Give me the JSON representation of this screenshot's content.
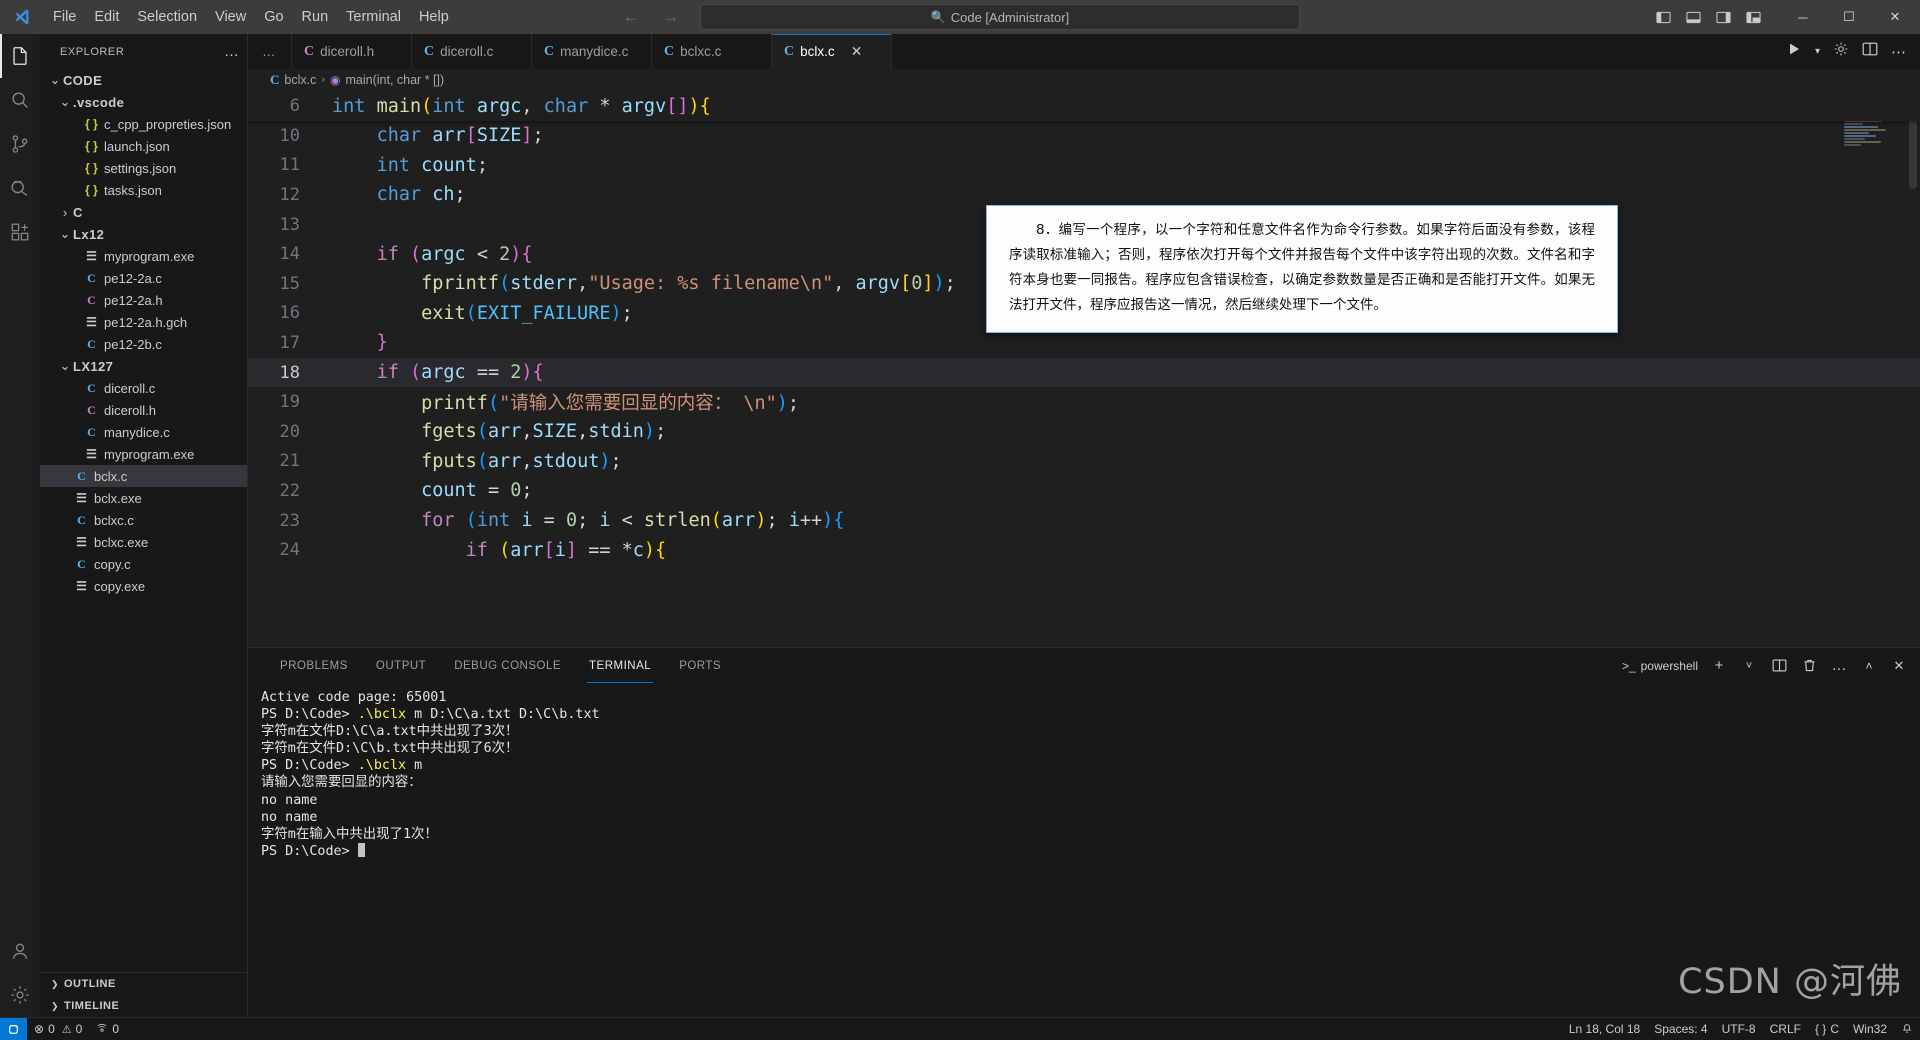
{
  "window": {
    "title": "Code [Administrator]",
    "search_placeholder": "Code [Administrator]",
    "accent": "#0078d4",
    "menu": [
      "File",
      "Edit",
      "Selection",
      "View",
      "Go",
      "Run",
      "Terminal",
      "Help"
    ],
    "controls": {
      "minimize": "─",
      "maximize": "☐",
      "close": "✕"
    },
    "nav": {
      "back": "←",
      "forward": "→"
    }
  },
  "activitybar": {
    "items": [
      {
        "name": "explorer",
        "icon": "files-icon",
        "active": true,
        "badge": ""
      },
      {
        "name": "search",
        "icon": "search-icon",
        "active": false,
        "badge": ""
      },
      {
        "name": "source-control",
        "icon": "source-control-icon",
        "active": false,
        "badge": ""
      },
      {
        "name": "run-and-debug",
        "icon": "run-debug-icon",
        "active": false,
        "badge": ""
      },
      {
        "name": "extensions",
        "icon": "extensions-icon",
        "active": false,
        "badge": ""
      }
    ],
    "bottom": [
      {
        "name": "accounts",
        "icon": "account-icon"
      },
      {
        "name": "manage",
        "icon": "gear-icon"
      }
    ]
  },
  "sidebar": {
    "title": "EXPLORER",
    "more_label": "…",
    "tree": [
      {
        "label": "CODE",
        "indent": 0,
        "type": "folder",
        "expanded": true,
        "selected": false
      },
      {
        "label": ".vscode",
        "indent": 1,
        "type": "folder",
        "expanded": true,
        "selected": false
      },
      {
        "label": "c_cpp_propreties.json",
        "indent": 2,
        "type": "json",
        "selected": false
      },
      {
        "label": "launch.json",
        "indent": 2,
        "type": "json",
        "selected": false
      },
      {
        "label": "settings.json",
        "indent": 2,
        "type": "json",
        "selected": false
      },
      {
        "label": "tasks.json",
        "indent": 2,
        "type": "json",
        "selected": false
      },
      {
        "label": "C",
        "indent": 1,
        "type": "folder",
        "expanded": false,
        "selected": false
      },
      {
        "label": "Lx12",
        "indent": 1,
        "type": "folder",
        "expanded": true,
        "selected": false
      },
      {
        "label": "myprogram.exe",
        "indent": 2,
        "type": "bin",
        "selected": false
      },
      {
        "label": "pe12-2a.c",
        "indent": 2,
        "type": "c",
        "selected": false
      },
      {
        "label": "pe12-2a.h",
        "indent": 2,
        "type": "h",
        "selected": false
      },
      {
        "label": "pe12-2a.h.gch",
        "indent": 2,
        "type": "bin",
        "selected": false
      },
      {
        "label": "pe12-2b.c",
        "indent": 2,
        "type": "c",
        "selected": false
      },
      {
        "label": "LX127",
        "indent": 1,
        "type": "folder",
        "expanded": true,
        "selected": false
      },
      {
        "label": "diceroll.c",
        "indent": 2,
        "type": "c",
        "selected": false
      },
      {
        "label": "diceroll.h",
        "indent": 2,
        "type": "h",
        "selected": false
      },
      {
        "label": "manydice.c",
        "indent": 2,
        "type": "c",
        "selected": false
      },
      {
        "label": "myprogram.exe",
        "indent": 2,
        "type": "bin",
        "selected": false
      },
      {
        "label": "bclx.c",
        "indent": 1,
        "type": "c",
        "selected": true
      },
      {
        "label": "bclx.exe",
        "indent": 1,
        "type": "bin",
        "selected": false
      },
      {
        "label": "bclxc.c",
        "indent": 1,
        "type": "c",
        "selected": false
      },
      {
        "label": "bclxc.exe",
        "indent": 1,
        "type": "bin",
        "selected": false
      },
      {
        "label": "copy.c",
        "indent": 1,
        "type": "c",
        "selected": false
      },
      {
        "label": "copy.exe",
        "indent": 1,
        "type": "bin",
        "selected": false
      }
    ],
    "sections": [
      {
        "label": "OUTLINE",
        "expanded": false
      },
      {
        "label": "TIMELINE",
        "expanded": false
      }
    ]
  },
  "editor": {
    "tabs": [
      {
        "label": "diceroll.h",
        "type": "h",
        "active": false,
        "closable": false
      },
      {
        "label": "diceroll.c",
        "type": "c",
        "active": false,
        "closable": false
      },
      {
        "label": "manydice.c",
        "type": "c",
        "active": false,
        "closable": false
      },
      {
        "label": "bclxc.c",
        "type": "c",
        "active": false,
        "closable": false
      },
      {
        "label": "bclx.c",
        "type": "c",
        "active": true,
        "closable": true,
        "close_label": "✕"
      }
    ],
    "tabs_overflow_label": "…",
    "breadcrumb": {
      "file": "bclx.c",
      "separator": "›",
      "symbol": "main(int, char * [])"
    },
    "sticky": {
      "line_no": "6",
      "tokens": [
        {
          "t": "int",
          "c": "k"
        },
        {
          "t": " ",
          "c": "op"
        },
        {
          "t": "main",
          "c": "fn"
        },
        {
          "t": "(",
          "c": "pl"
        },
        {
          "t": "int",
          "c": "k"
        },
        {
          "t": " ",
          "c": "op"
        },
        {
          "t": "argc",
          "c": "vr"
        },
        {
          "t": ", ",
          "c": "op"
        },
        {
          "t": "char",
          "c": "k"
        },
        {
          "t": " ",
          "c": "op"
        },
        {
          "t": "*",
          "c": "op"
        },
        {
          "t": " ",
          "c": "op"
        },
        {
          "t": "argv",
          "c": "vr"
        },
        {
          "t": "[",
          "c": "p2"
        },
        {
          "t": "]",
          "c": "p2"
        },
        {
          "t": ")",
          "c": "pl"
        },
        {
          "t": "{",
          "c": "pl"
        }
      ]
    },
    "lines": [
      {
        "no": "10",
        "current": false,
        "tokens": [
          {
            "t": "    ",
            "c": "op"
          },
          {
            "t": "char",
            "c": "k"
          },
          {
            "t": " ",
            "c": "op"
          },
          {
            "t": "arr",
            "c": "vr"
          },
          {
            "t": "[",
            "c": "p2"
          },
          {
            "t": "SIZE",
            "c": "vr"
          },
          {
            "t": "]",
            "c": "p2"
          },
          {
            "t": ";",
            "c": "op"
          }
        ]
      },
      {
        "no": "11",
        "current": false,
        "tokens": [
          {
            "t": "    ",
            "c": "op"
          },
          {
            "t": "int",
            "c": "k"
          },
          {
            "t": " ",
            "c": "op"
          },
          {
            "t": "count",
            "c": "vr"
          },
          {
            "t": ";",
            "c": "op"
          }
        ]
      },
      {
        "no": "12",
        "current": false,
        "tokens": [
          {
            "t": "    ",
            "c": "op"
          },
          {
            "t": "char",
            "c": "k"
          },
          {
            "t": " ",
            "c": "op"
          },
          {
            "t": "ch",
            "c": "vr"
          },
          {
            "t": ";",
            "c": "op"
          }
        ]
      },
      {
        "no": "13",
        "current": false,
        "tokens": [
          {
            "t": "",
            "c": "op"
          }
        ]
      },
      {
        "no": "14",
        "current": false,
        "tokens": [
          {
            "t": "    ",
            "c": "op"
          },
          {
            "t": "if",
            "c": "kc"
          },
          {
            "t": " ",
            "c": "op"
          },
          {
            "t": "(",
            "c": "p2"
          },
          {
            "t": "argc",
            "c": "vr"
          },
          {
            "t": " ",
            "c": "op"
          },
          {
            "t": "<",
            "c": "op"
          },
          {
            "t": " ",
            "c": "op"
          },
          {
            "t": "2",
            "c": "nu"
          },
          {
            "t": ")",
            "c": "p2"
          },
          {
            "t": "{",
            "c": "p2"
          }
        ]
      },
      {
        "no": "15",
        "current": false,
        "tokens": [
          {
            "t": "        ",
            "c": "op"
          },
          {
            "t": "fprintf",
            "c": "fn"
          },
          {
            "t": "(",
            "c": "p3"
          },
          {
            "t": "stderr",
            "c": "vr"
          },
          {
            "t": ",",
            "c": "op"
          },
          {
            "t": "\"Usage: %s filename\\n\"",
            "c": "st"
          },
          {
            "t": ", ",
            "c": "op"
          },
          {
            "t": "argv",
            "c": "vr"
          },
          {
            "t": "[",
            "c": "pl"
          },
          {
            "t": "0",
            "c": "nu"
          },
          {
            "t": "]",
            "c": "pl"
          },
          {
            "t": ")",
            "c": "p3"
          },
          {
            "t": ";",
            "c": "op"
          }
        ]
      },
      {
        "no": "16",
        "current": false,
        "tokens": [
          {
            "t": "        ",
            "c": "op"
          },
          {
            "t": "exit",
            "c": "fn"
          },
          {
            "t": "(",
            "c": "p3"
          },
          {
            "t": "EXIT_FAILURE",
            "c": "cst"
          },
          {
            "t": ")",
            "c": "p3"
          },
          {
            "t": ";",
            "c": "op"
          }
        ]
      },
      {
        "no": "17",
        "current": false,
        "tokens": [
          {
            "t": "    ",
            "c": "op"
          },
          {
            "t": "}",
            "c": "p2"
          }
        ]
      },
      {
        "no": "18",
        "current": true,
        "tokens": [
          {
            "t": "    ",
            "c": "op"
          },
          {
            "t": "if",
            "c": "kc"
          },
          {
            "t": " ",
            "c": "op"
          },
          {
            "t": "(",
            "c": "p2"
          },
          {
            "t": "argc",
            "c": "vr"
          },
          {
            "t": " ",
            "c": "op"
          },
          {
            "t": "==",
            "c": "op"
          },
          {
            "t": " ",
            "c": "op"
          },
          {
            "t": "2",
            "c": "nu"
          },
          {
            "t": ")",
            "c": "p2"
          },
          {
            "t": "{",
            "c": "p2"
          }
        ]
      },
      {
        "no": "19",
        "current": false,
        "tokens": [
          {
            "t": "        ",
            "c": "op"
          },
          {
            "t": "printf",
            "c": "fn"
          },
          {
            "t": "(",
            "c": "p3"
          },
          {
            "t": "\"请输入您需要回显的内容： \\n\"",
            "c": "st"
          },
          {
            "t": ")",
            "c": "p3"
          },
          {
            "t": ";",
            "c": "op"
          }
        ]
      },
      {
        "no": "20",
        "current": false,
        "tokens": [
          {
            "t": "        ",
            "c": "op"
          },
          {
            "t": "fgets",
            "c": "fn"
          },
          {
            "t": "(",
            "c": "p3"
          },
          {
            "t": "arr",
            "c": "vr"
          },
          {
            "t": ",",
            "c": "op"
          },
          {
            "t": "SIZE",
            "c": "vr"
          },
          {
            "t": ",",
            "c": "op"
          },
          {
            "t": "stdin",
            "c": "vr"
          },
          {
            "t": ")",
            "c": "p3"
          },
          {
            "t": ";",
            "c": "op"
          }
        ]
      },
      {
        "no": "21",
        "current": false,
        "tokens": [
          {
            "t": "        ",
            "c": "op"
          },
          {
            "t": "fputs",
            "c": "fn"
          },
          {
            "t": "(",
            "c": "p3"
          },
          {
            "t": "arr",
            "c": "vr"
          },
          {
            "t": ",",
            "c": "op"
          },
          {
            "t": "stdout",
            "c": "vr"
          },
          {
            "t": ")",
            "c": "p3"
          },
          {
            "t": ";",
            "c": "op"
          }
        ]
      },
      {
        "no": "22",
        "current": false,
        "tokens": [
          {
            "t": "        ",
            "c": "op"
          },
          {
            "t": "count",
            "c": "vr"
          },
          {
            "t": " = ",
            "c": "op"
          },
          {
            "t": "0",
            "c": "nu"
          },
          {
            "t": ";",
            "c": "op"
          }
        ]
      },
      {
        "no": "23",
        "current": false,
        "tokens": [
          {
            "t": "        ",
            "c": "op"
          },
          {
            "t": "for",
            "c": "kc"
          },
          {
            "t": " ",
            "c": "op"
          },
          {
            "t": "(",
            "c": "p3"
          },
          {
            "t": "int",
            "c": "k"
          },
          {
            "t": " ",
            "c": "op"
          },
          {
            "t": "i",
            "c": "vr"
          },
          {
            "t": " = ",
            "c": "op"
          },
          {
            "t": "0",
            "c": "nu"
          },
          {
            "t": "; ",
            "c": "op"
          },
          {
            "t": "i",
            "c": "vr"
          },
          {
            "t": " < ",
            "c": "op"
          },
          {
            "t": "strlen",
            "c": "fn"
          },
          {
            "t": "(",
            "c": "pl"
          },
          {
            "t": "arr",
            "c": "vr"
          },
          {
            "t": ")",
            "c": "pl"
          },
          {
            "t": "; ",
            "c": "op"
          },
          {
            "t": "i",
            "c": "vr"
          },
          {
            "t": "++",
            "c": "op"
          },
          {
            "t": ")",
            "c": "p3"
          },
          {
            "t": "{",
            "c": "p3"
          }
        ]
      },
      {
        "no": "24",
        "current": false,
        "tokens": [
          {
            "t": "            ",
            "c": "op"
          },
          {
            "t": "if",
            "c": "kc"
          },
          {
            "t": " ",
            "c": "op"
          },
          {
            "t": "(",
            "c": "pl"
          },
          {
            "t": "arr",
            "c": "vr"
          },
          {
            "t": "[",
            "c": "p2"
          },
          {
            "t": "i",
            "c": "vr"
          },
          {
            "t": "]",
            "c": "p2"
          },
          {
            "t": " == ",
            "c": "op"
          },
          {
            "t": "*",
            "c": "op"
          },
          {
            "t": "c",
            "c": "vr"
          },
          {
            "t": ")",
            "c": "pl"
          },
          {
            "t": "{",
            "c": "pl"
          }
        ]
      }
    ],
    "hover_card": {
      "text": "8．编写一个程序，以一个字符和任意文件名作为命令行参数。如果字符后面没有参数，该程序读取标准输入；否则，程序依次打开每个文件并报告每个文件中该字符出现的次数。文件名和字符本身也要一同报告。程序应包含错误检查，以确定参数数量是否正确和是否能打开文件。如果无法打开文件，程序应报告这一情况，然后继续处理下一个文件。"
    }
  },
  "panel": {
    "tabs": [
      "PROBLEMS",
      "OUTPUT",
      "DEBUG CONSOLE",
      "TERMINAL",
      "PORTS"
    ],
    "active_tab": "TERMINAL",
    "shell_label": "powershell",
    "actions": {
      "new_terminal": "+",
      "dropdown": "˅",
      "split": "split-terminal-icon",
      "kill": "trash-icon",
      "more": "…",
      "maximize": "˄",
      "close": "✕"
    },
    "terminal_lines": [
      {
        "segments": [
          {
            "t": "Active code page: 65001",
            "c": "t-white"
          }
        ]
      },
      {
        "segments": [
          {
            "t": "PS D:\\Code> ",
            "c": "t-white"
          },
          {
            "t": ".\\bclx",
            "c": "t-yellow"
          },
          {
            "t": " m D:\\C\\a.txt D:\\C\\b.txt",
            "c": "t-white"
          }
        ]
      },
      {
        "segments": [
          {
            "t": "字符m在文件D:\\C\\a.txt中共出现了3次！",
            "c": "t-white"
          }
        ]
      },
      {
        "segments": [
          {
            "t": "字符m在文件D:\\C\\b.txt中共出现了6次！",
            "c": "t-white"
          }
        ]
      },
      {
        "segments": [
          {
            "t": "PS D:\\Code> ",
            "c": "t-white"
          },
          {
            "t": ".\\bclx",
            "c": "t-yellow"
          },
          {
            "t": " m",
            "c": "t-white"
          }
        ]
      },
      {
        "segments": [
          {
            "t": "请输入您需要回显的内容：",
            "c": "t-white"
          }
        ]
      },
      {
        "segments": [
          {
            "t": "no name",
            "c": "t-white"
          }
        ]
      },
      {
        "segments": [
          {
            "t": "no name",
            "c": "t-white"
          }
        ]
      },
      {
        "segments": [
          {
            "t": "字符m在输入中共出现了1次！",
            "c": "t-white"
          }
        ]
      },
      {
        "segments": [
          {
            "t": "PS D:\\Code> ",
            "c": "t-white"
          }
        ],
        "caret": true
      }
    ]
  },
  "statusbar": {
    "remote_icon": "remote-indicator-icon",
    "errors": "0",
    "warnings": "0",
    "ports_count": "0",
    "ports_icon": "radio-tower-icon",
    "error_icon": "⊗",
    "warning_icon": "⚠",
    "right": [
      {
        "name": "cursor-position",
        "label": "Ln 18, Col 18"
      },
      {
        "name": "indentation",
        "label": "Spaces: 4"
      },
      {
        "name": "encoding",
        "label": "UTF-8"
      },
      {
        "name": "eol",
        "label": "CRLF"
      },
      {
        "name": "language-mode",
        "label": "C"
      },
      {
        "name": "win32",
        "label": "Win32"
      }
    ],
    "bell_icon": "🔔"
  },
  "watermark": {
    "text": "CSDN @河佛"
  }
}
